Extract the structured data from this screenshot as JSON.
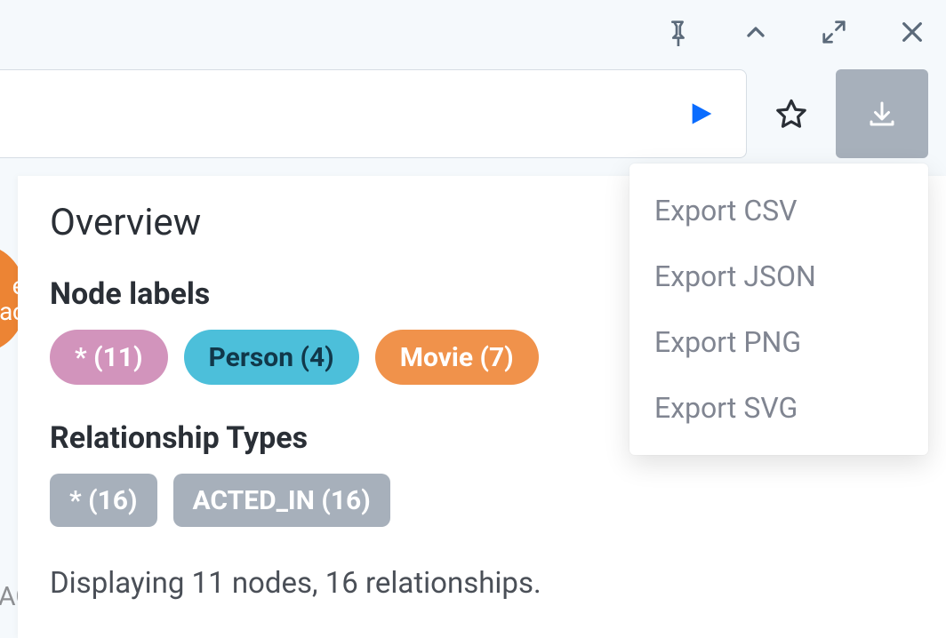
{
  "toolbar": {
    "pin_icon": "pin",
    "collapse_icon": "chevron-up",
    "expand_icon": "expand",
    "close_icon": "close"
  },
  "action_bar": {
    "play": "run",
    "favorite": "star",
    "download": "download"
  },
  "export_menu": {
    "items": [
      "Export CSV",
      "Export JSON",
      "Export PNG",
      "Export SVG"
    ]
  },
  "overview": {
    "title": "Overview",
    "node_labels_heading": "Node labels",
    "node_labels": [
      {
        "label": "* (11)",
        "kind": "all"
      },
      {
        "label": "Person (4)",
        "kind": "person"
      },
      {
        "label": "Movie (7)",
        "kind": "movie"
      }
    ],
    "relationship_heading": "Relationship Types",
    "relationship_types": [
      {
        "label": "* (16)"
      },
      {
        "label": "ACTED_IN (16)"
      }
    ],
    "status": "Displaying 11 nodes, 16 relationships."
  },
  "background_nodes": {
    "partial_label_top": "e\nac",
    "partial_label_bottom": "AC"
  }
}
